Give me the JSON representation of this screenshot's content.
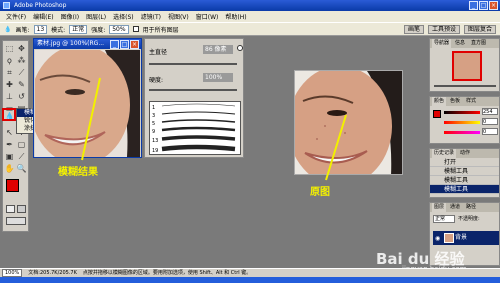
{
  "window": {
    "title": "Adobe Photoshop",
    "minimize": "_",
    "maximize": "□",
    "close": "×"
  },
  "menu": [
    "文件(F)",
    "编辑(E)",
    "图像(I)",
    "图层(L)",
    "选择(S)",
    "滤镜(T)",
    "视图(V)",
    "窗口(W)",
    "帮助(H)"
  ],
  "options": {
    "brush_label": "画笔:",
    "brush_size": "13",
    "mode_label": "模式:",
    "mode_value": "正常",
    "strength_label": "强度:",
    "strength_value": "50%",
    "all_layers": "用于所有图层",
    "tabs": [
      "画笔",
      "工具预设",
      "图层复合"
    ]
  },
  "document": {
    "title": "素材.jpg @ 100%(RG..."
  },
  "flyout": {
    "items": [
      "模糊工具",
      "锐化工具",
      "涂抹工具"
    ],
    "shortcuts": [
      "R",
      "R",
      "R"
    ]
  },
  "brush_panel": {
    "master_label": "主直径",
    "size_value": "86 像素",
    "hardness_label": "硬度:",
    "hardness_value": "100%",
    "preset_numbers": [
      "1",
      "3",
      "5",
      "9",
      "13",
      "19"
    ]
  },
  "navigator": {
    "tabs": [
      "导航器",
      "信息",
      "直方图"
    ]
  },
  "color_panel": {
    "tabs": [
      "颜色",
      "色板",
      "样式"
    ],
    "values": [
      "254",
      "0",
      "0"
    ]
  },
  "history": {
    "tabs": [
      "历史记录",
      "动作"
    ],
    "items": [
      "打开",
      "模糊工具",
      "模糊工具",
      "模糊工具"
    ]
  },
  "layers": {
    "tabs": [
      "图层",
      "通道",
      "路径"
    ],
    "mode": "正常",
    "opacity": "不透明度:",
    "layer_name": "背景"
  },
  "status": {
    "zoom": "100%",
    "doc_info": "文档:205.7K/205.7K",
    "hint": "点按并拖移以模糊图像的区域。要用附加选项，使用 Shift、Alt 和 Ctrl 键。"
  },
  "annotations": {
    "result_label": "模糊结果",
    "original_label": "原图"
  },
  "watermark": {
    "brand": "Bai du 经验",
    "url": "jingyan.baidu.com"
  },
  "colors": {
    "annotation": "#f3f000",
    "foreground": "#e00000",
    "titlebar": "#0a3aa8"
  }
}
